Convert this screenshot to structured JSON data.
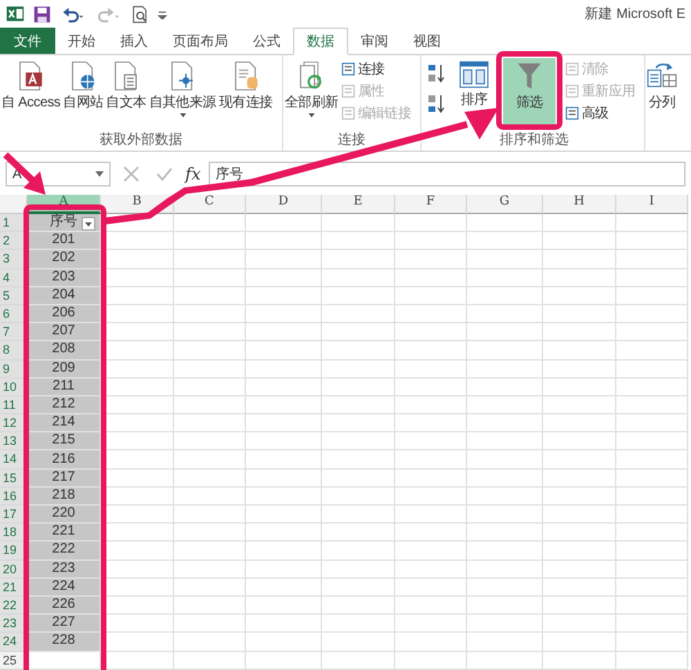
{
  "window": {
    "title": "新建 Microsoft E"
  },
  "tabs": [
    {
      "label": "文件",
      "kind": "file",
      "selected": false
    },
    {
      "label": "开始",
      "kind": "tab",
      "selected": false
    },
    {
      "label": "插入",
      "kind": "tab",
      "selected": false
    },
    {
      "label": "页面布局",
      "kind": "tab",
      "selected": false
    },
    {
      "label": "公式",
      "kind": "tab",
      "selected": false
    },
    {
      "label": "数据",
      "kind": "tab",
      "selected": true
    },
    {
      "label": "审阅",
      "kind": "tab",
      "selected": false
    },
    {
      "label": "视图",
      "kind": "tab",
      "selected": false
    }
  ],
  "ribbon": {
    "groups": [
      {
        "label": "获取外部数据",
        "buttons": [
          {
            "label": "自 Access",
            "kind": "large",
            "dropdown": false
          },
          {
            "label": "自网站",
            "kind": "large",
            "dropdown": false
          },
          {
            "label": "自文本",
            "kind": "large",
            "dropdown": false
          },
          {
            "label": "自其他来源",
            "kind": "large",
            "dropdown": true
          },
          {
            "label": "现有连接",
            "kind": "large",
            "dropdown": false
          }
        ]
      },
      {
        "label": "连接",
        "buttons": [
          {
            "label": "全部刷新",
            "kind": "large",
            "dropdown": true
          },
          {
            "label": "连接",
            "kind": "small",
            "disabled": false
          },
          {
            "label": "属性",
            "kind": "small",
            "disabled": true
          },
          {
            "label": "编辑链接",
            "kind": "small",
            "disabled": true
          }
        ]
      },
      {
        "label": "排序和筛选",
        "buttons": [
          {
            "label": "排序",
            "kind": "sort"
          },
          {
            "label": "筛选",
            "kind": "large",
            "selected": true
          },
          {
            "label": "清除",
            "kind": "small",
            "disabled": true
          },
          {
            "label": "重新应用",
            "kind": "small",
            "disabled": true
          },
          {
            "label": "高级",
            "kind": "small",
            "disabled": false
          }
        ]
      },
      {
        "buttons": [
          {
            "label": "分列",
            "kind": "large",
            "dropdown": false
          }
        ]
      }
    ]
  },
  "formula_bar": {
    "name_box": "A",
    "function_label": "fx",
    "value": "序号"
  },
  "columns": [
    {
      "label": "A",
      "selected": true
    },
    {
      "label": "B",
      "selected": false
    },
    {
      "label": "C",
      "selected": false
    },
    {
      "label": "D",
      "selected": false
    },
    {
      "label": "E",
      "selected": false
    },
    {
      "label": "F",
      "selected": false
    },
    {
      "label": "G",
      "selected": false
    },
    {
      "label": "H",
      "selected": false
    },
    {
      "label": "I",
      "selected": false
    }
  ],
  "rows": [
    {
      "number": "1",
      "kind": "header",
      "value": "序号",
      "selected": true
    },
    {
      "number": "2",
      "kind": "data",
      "value": "201",
      "selected": true
    },
    {
      "number": "3",
      "kind": "data",
      "value": "202",
      "selected": true
    },
    {
      "number": "4",
      "kind": "data",
      "value": "203",
      "selected": true
    },
    {
      "number": "5",
      "kind": "data",
      "value": "204",
      "selected": true
    },
    {
      "number": "6",
      "kind": "data",
      "value": "206",
      "selected": true
    },
    {
      "number": "7",
      "kind": "data",
      "value": "207",
      "selected": true
    },
    {
      "number": "8",
      "kind": "data",
      "value": "208",
      "selected": true
    },
    {
      "number": "9",
      "kind": "data",
      "value": "209",
      "selected": true
    },
    {
      "number": "10",
      "kind": "data",
      "value": "211",
      "selected": true
    },
    {
      "number": "11",
      "kind": "data",
      "value": "212",
      "selected": true
    },
    {
      "number": "12",
      "kind": "data",
      "value": "214",
      "selected": true
    },
    {
      "number": "13",
      "kind": "data",
      "value": "215",
      "selected": true
    },
    {
      "number": "14",
      "kind": "data",
      "value": "216",
      "selected": true
    },
    {
      "number": "15",
      "kind": "data",
      "value": "217",
      "selected": true
    },
    {
      "number": "16",
      "kind": "data",
      "value": "218",
      "selected": true
    },
    {
      "number": "17",
      "kind": "data",
      "value": "220",
      "selected": true
    },
    {
      "number": "18",
      "kind": "data",
      "value": "221",
      "selected": true
    },
    {
      "number": "19",
      "kind": "data",
      "value": "222",
      "selected": true
    },
    {
      "number": "20",
      "kind": "data",
      "value": "223",
      "selected": true
    },
    {
      "number": "21",
      "kind": "data",
      "value": "224",
      "selected": true
    },
    {
      "number": "22",
      "kind": "data",
      "value": "226",
      "selected": true
    },
    {
      "number": "23",
      "kind": "data",
      "value": "227",
      "selected": true
    },
    {
      "number": "24",
      "kind": "data",
      "value": "228",
      "selected": true
    },
    {
      "number": "25",
      "kind": "data",
      "selected": false
    }
  ]
}
